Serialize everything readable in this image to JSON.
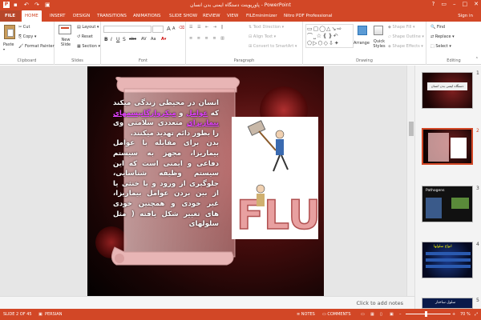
{
  "window": {
    "title": "پاورپوینت دستگاه ایمنی بدن انسان - PowerPoint",
    "help": "?"
  },
  "tabs": [
    "FILE",
    "HOME",
    "INSERT",
    "DESIGN",
    "TRANSITIONS",
    "ANIMATIONS",
    "SLIDE SHOW",
    "REVIEW",
    "VIEW",
    "FILEminimizer",
    "Nitro PDF Professional"
  ],
  "signin": "Sign in",
  "ribbon": {
    "clipboard": {
      "paste": "Paste",
      "cut": "Cut",
      "copy": "Copy",
      "format_painter": "Format Painter",
      "label": "Clipboard"
    },
    "slides": {
      "new_slide": "New Slide",
      "layout": "Layout",
      "reset": "Reset",
      "section": "Section",
      "label": "Slides"
    },
    "font": {
      "label": "Font",
      "bold": "B",
      "italic": "I",
      "underline": "U",
      "strike": "S",
      "abc": "abc",
      "aa": "Aa",
      "grow": "A",
      "shrink": "A"
    },
    "paragraph": {
      "text_direction": "Text Direction",
      "align_text": "Align Text",
      "smartart": "Convert to SmartArt",
      "label": "Paragraph"
    },
    "drawing": {
      "arrange": "Arrange",
      "quick_styles": "Quick Styles",
      "shape_fill": "Shape Fill",
      "shape_outline": "Shape Outline",
      "shape_effects": "Shape Effects",
      "label": "Drawing"
    },
    "editing": {
      "find": "Find",
      "replace": "Replace",
      "select": "Select",
      "label": "Editing"
    }
  },
  "thumbs": [
    {
      "num": "1",
      "title": "دستگاه ایمنی بدن انسان"
    },
    {
      "num": "2",
      "title": ""
    },
    {
      "num": "3",
      "title": "Pathogens"
    },
    {
      "num": "4",
      "title": "انواع سلولها"
    },
    {
      "num": "5",
      "title": "سلول ساختار"
    }
  ],
  "slide": {
    "p1_before": "انسان در محیطی زندگی میکند که ",
    "p1_link1": "عوامل",
    "p1_mid": " و ",
    "p1_link2": "میکروارگانیسمهای بیماریزای",
    "p1_after": " متعددی سلامتی وی را بطور دائم تهدید میکنند.",
    "p2": "بدن برای مقابله با عوامل بیماریزا، مجهز به سیستم دفاعی و ایمنی است که این سیستم وظیفه شناسایی، جلوگیری از ورود و یا خنثی یا از بین بردن عوامل بیماریزا، غیر خودی و همچنین خودی های تغییر شکل یافته ( مثل سلولهای"
  },
  "notes": "Click to add notes",
  "status": {
    "slide": "SLIDE 2 OF 45",
    "lang": "PERSIAN",
    "notes": "NOTES",
    "comments": "COMMENTS",
    "zoom": "70 %"
  }
}
